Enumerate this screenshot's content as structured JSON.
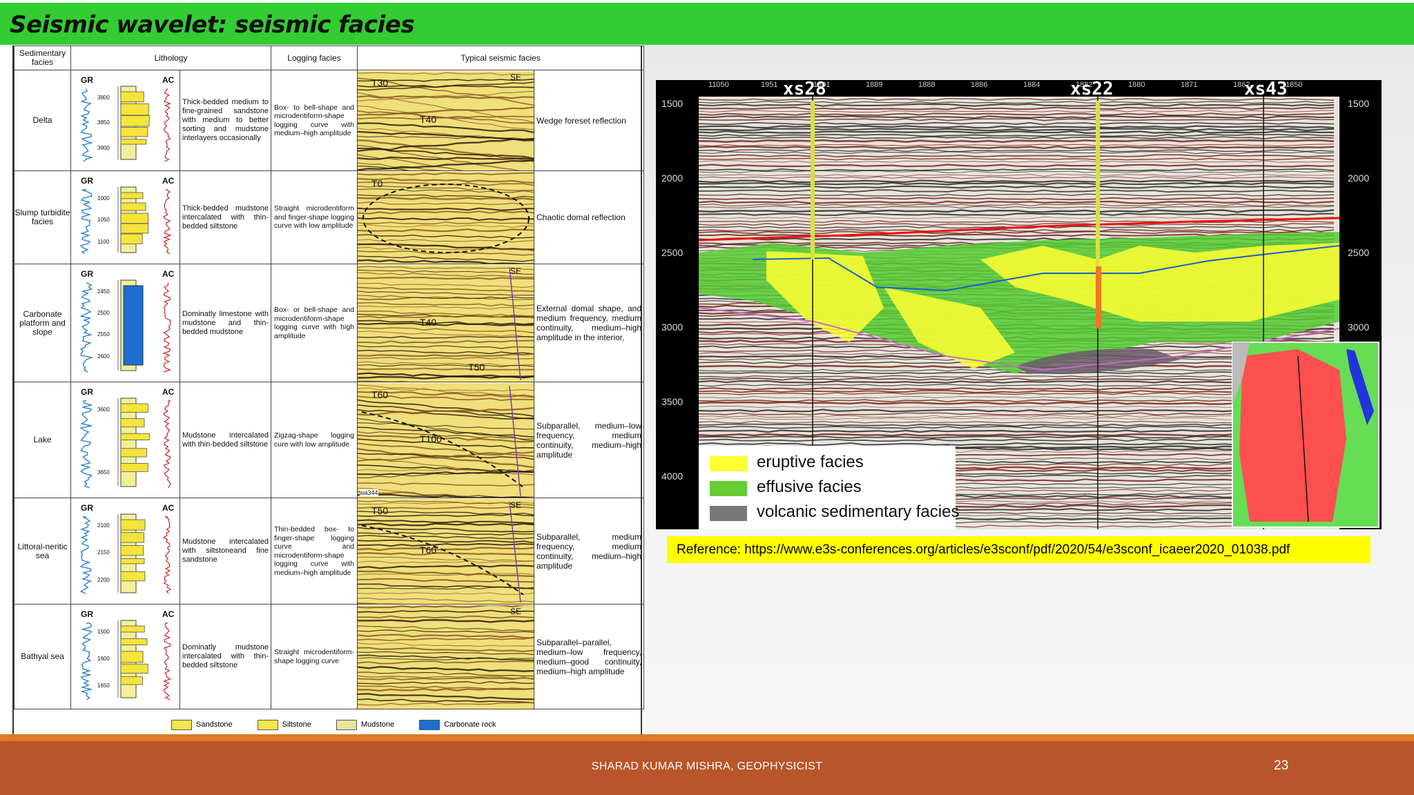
{
  "slide": {
    "title": "Seismic wavelet: seismic facies",
    "author": "SHARAD KUMAR MISHRA, GEOPHYSICIST",
    "page_number": "23"
  },
  "colors": {
    "title_bar": "#33cc33",
    "footer": "#b9552a",
    "footer_accent": "#dd7a22",
    "reference_bar": "#ffff00"
  },
  "table": {
    "headers": [
      "Sedimentary facies",
      "Lithology",
      "Logging facies",
      "Typical seismic facies"
    ],
    "log_labels": {
      "gr": "GR",
      "ac": "AC"
    },
    "rows": [
      {
        "facies": "Delta",
        "depths": [
          "3800",
          "3850",
          "3900"
        ],
        "lithology": "Thick-bedded medium to fine-grained sandstone with medium to better sorting and mudstone interlayers occasionally",
        "logging": "Box- to bell-shape and microdentiform-shape logging curve with medium–high amplitude",
        "seismic_labels": [
          "T30",
          "T40",
          "SE"
        ],
        "typical": "Wedge foreset reflection"
      },
      {
        "facies": "Slump turbidite facies",
        "depths": [
          "1000",
          "1050",
          "1100"
        ],
        "lithology": "Thick-bedded mudstone intercalated with thin-bedded siltstone",
        "logging": "Straight microdentiform and finger-shape logging curve with low amplitude",
        "seismic_labels": [
          "T0"
        ],
        "typical": "Chaotic domal reflection"
      },
      {
        "facies": "Carbonate platform and slope",
        "depths": [
          "2450",
          "2500",
          "2550",
          "2600"
        ],
        "lithology": "Dominatly limestone with mudstone and thin-bedded mudstone",
        "logging": "Box- or bell-shape and microdentiform-shape logging curve with high amplitude",
        "seismic_labels": [
          "SE",
          "T40",
          "T50"
        ],
        "typical": "External domal shape, and medium frequency, medium continuity, medium–high amplitude in the interior,"
      },
      {
        "facies": "Lake",
        "depths": [
          "3600",
          "3650"
        ],
        "lithology": "Mudstone intercalated with thin-bedded siltstone",
        "logging": "Zigzag-shape logging cure with low amplitude",
        "seismic_labels": [
          "T60",
          "T100",
          "wa344"
        ],
        "typical": "Subparallel, medium–low frequency, medium continuity, medium–high amplitude"
      },
      {
        "facies": "Littoral-neritic sea",
        "depths": [
          "2100",
          "2150",
          "2200"
        ],
        "lithology": "Mudstone intercalated with siltstoneand fine sandstone",
        "logging": "Thin-bedded box- to finger-shape logging curve and microdentiform-shape logging curve with medium–high amplitude",
        "seismic_labels": [
          "T50",
          "T60",
          "SE"
        ],
        "typical": "Subparallel, medium frequency, medium continuity, medium–high amplitude"
      },
      {
        "facies": "Bathyal sea",
        "depths": [
          "1500",
          "1600",
          "1650"
        ],
        "lithology": "Dominatly mudstone intercalated with thin-bedded siltstone",
        "logging": "Straight microdentiform-shape logging curve",
        "seismic_labels": [
          "SE"
        ],
        "typical": "Subparallel–parallel, medium–low frequency, medium–good continuity, medium–high amplitude"
      }
    ],
    "legend": [
      {
        "label": "Sandstone",
        "color": "#f2e64a"
      },
      {
        "label": "Siltstone",
        "color": "#f2e64a"
      },
      {
        "label": "Mudstone",
        "color": "#e6e6a0"
      },
      {
        "label": "Carbonate rock",
        "color": "#1f6fd0"
      }
    ]
  },
  "seismic_section": {
    "wells": [
      "xs28",
      "xs22",
      "xs43"
    ],
    "time_ticks": [
      "1500",
      "2000",
      "2500",
      "3000",
      "3500",
      "4000"
    ],
    "trace_numbers": [
      "11050",
      "1951",
      "1891",
      "1889",
      "1888",
      "1886",
      "1884",
      "1882",
      "1880",
      "1871",
      "1862",
      "1850"
    ],
    "legend": [
      {
        "label": "eruptive facies",
        "color": "#ffff33"
      },
      {
        "label": "effusive facies",
        "color": "#66cc33"
      },
      {
        "label": "volcanic sedimentary facies",
        "color": "#777777"
      }
    ]
  },
  "reference": "Reference: https://www.e3s-conferences.org/articles/e3sconf/pdf/2020/54/e3sconf_icaeer2020_01038.pdf"
}
